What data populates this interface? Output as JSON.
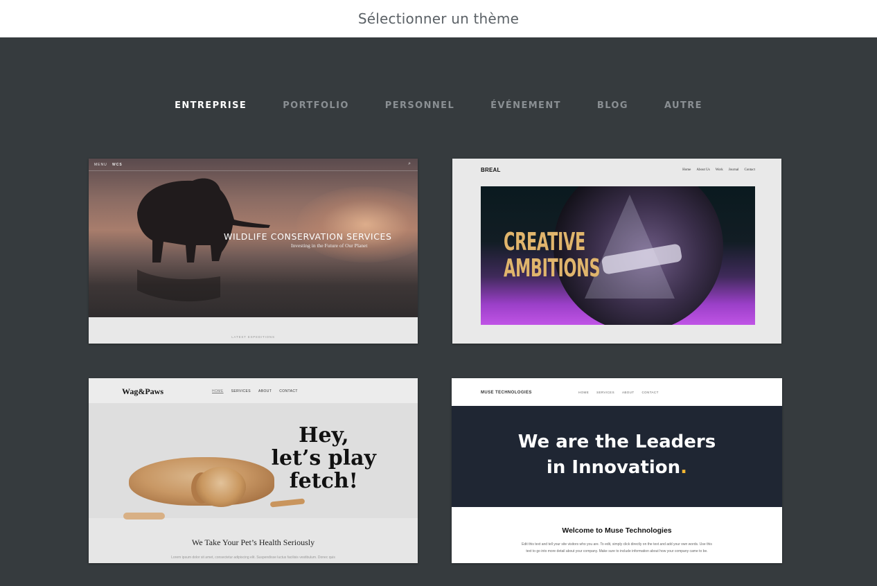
{
  "header": {
    "title": "Sélectionner un thème"
  },
  "tabs": [
    {
      "label": "ENTREPRISE",
      "active": true
    },
    {
      "label": "PORTFOLIO",
      "active": false
    },
    {
      "label": "PERSONNEL",
      "active": false
    },
    {
      "label": "ÉVÉNEMENT",
      "active": false
    },
    {
      "label": "BLOG",
      "active": false
    },
    {
      "label": "AUTRE",
      "active": false
    }
  ],
  "themes": {
    "wildlife": {
      "nav_menu": "MENU",
      "nav_brand": "WCS",
      "title": "WILDLIFE CONSERVATION SERVICES",
      "subtitle": "Investing in the Future of Our Planet",
      "footer_label": "LATEST EXPEDITIONS"
    },
    "breal": {
      "logo": "BREAL",
      "nav": [
        "Home",
        "About Us",
        "Work",
        "Journal",
        "Contact"
      ],
      "headline_1": "CREATIVE",
      "headline_2": "AMBITIONS",
      "accent_color": "#e0b56c"
    },
    "wagpaws": {
      "logo": "Wag&Paws",
      "nav": [
        "HOME",
        "SERVICES",
        "ABOUT",
        "CONTACT"
      ],
      "headline_1": "Hey,",
      "headline_2": "let’s play",
      "headline_3": "fetch!",
      "subtitle": "We Take Your Pet’s Health Seriously",
      "lorem": "Lorem ipsum dolor sit amet, consectetur adipiscing elit. Suspendisse luctus facilisis vestibulum. Donec quis"
    },
    "muse": {
      "logo": "MUSE TECHNOLOGIES",
      "nav": [
        "HOME",
        "SERVICES",
        "ABOUT",
        "CONTACT"
      ],
      "headline_1": "We are the Leaders",
      "headline_2": "in Innovation",
      "headline_dot": ".",
      "welcome": "Welcome to Muse Technologies",
      "body": "Edit this text and tell your site visitors who you are. To edit, simply click directly on the text and add your own words. Use this text to go into more detail about your company. Make sure to include information about how your company came to be.",
      "accent_color": "#f2b632"
    }
  }
}
